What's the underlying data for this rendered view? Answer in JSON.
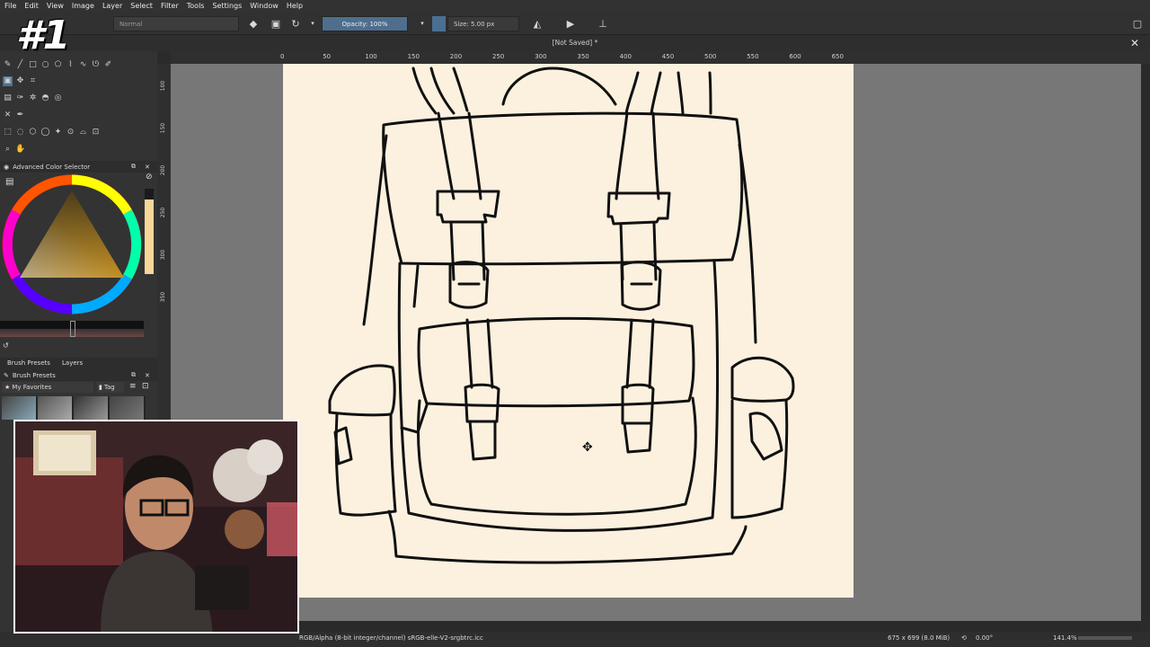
{
  "menu": [
    "File",
    "Edit",
    "View",
    "Image",
    "Layer",
    "Select",
    "Filter",
    "Tools",
    "Settings",
    "Window",
    "Help"
  ],
  "toolbar": {
    "blend_mode": "Normal",
    "opacity_label": "Opacity: 100%",
    "size_label": "Size: 5.00 px"
  },
  "document": {
    "title": "[Not Saved]  *"
  },
  "ruler_top_ticks": [
    "0",
    "50",
    "100",
    "150",
    "200",
    "250",
    "300",
    "350",
    "400",
    "450",
    "500",
    "550",
    "600",
    "650"
  ],
  "ruler_left_ticks": [
    "100",
    "150",
    "200",
    "250",
    "300",
    "350"
  ],
  "panels": {
    "color_selector_title": "Advanced Color Selector",
    "brush_presets_tab": "Brush Presets",
    "layers_tab": "Layers",
    "brush_presets_title": "Brush Presets",
    "favorites_label": "My Favorites",
    "tag_label": "Tag"
  },
  "status": {
    "color_space": "RGB/Alpha (8-bit integer/channel)  sRGB-elle-V2-srgbtrc.icc",
    "dimensions": "675 x 699 (8.0 MiB)",
    "rotation": "0.00°",
    "zoom": "141.4%"
  },
  "overlay": {
    "badge_text": "#1"
  },
  "colors": {
    "paper": "#fbf1de",
    "canvas_bg": "#777777",
    "accent": "#4f6e8d"
  },
  "icons": [
    "eraser-icon",
    "alpha-lock-icon",
    "reload-icon",
    "mirror-icon",
    "wrap-icon",
    "move-cursor-icon"
  ]
}
